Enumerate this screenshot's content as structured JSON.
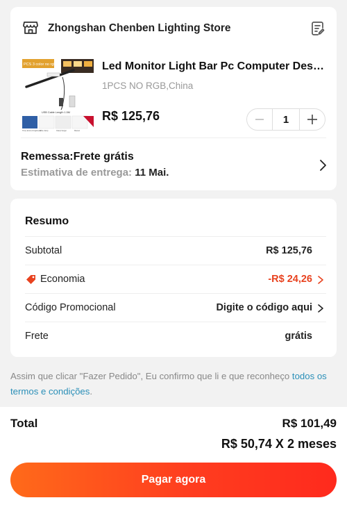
{
  "store": {
    "name": "Zhongshan Chenben Lighting Store",
    "icon": "storefront-icon",
    "note_icon": "note-edit-icon"
  },
  "product": {
    "title": "Led Monitor Light Bar Pc Computer Desk ...",
    "variant": "1PCS NO RGB,China",
    "price": "R$ 125,76",
    "quantity": "1",
    "image": {
      "banner_text": "PCS 3 color no rgb",
      "cable_text": "USB Cable Length 1.5M",
      "captions": [
        "Three kinds of brightness",
        "Wide clamp",
        "Clamp hanger",
        "Manual"
      ]
    }
  },
  "shipping": {
    "title": "Remessa:Frete grátis",
    "estimate_label": "Estimativa de entrega: ",
    "estimate_date": "11 Mai."
  },
  "summary": {
    "title": "Resumo",
    "rows": [
      {
        "label": "Subtotal",
        "value": "R$ 125,76"
      },
      {
        "label": "Economia",
        "value": "-R$ 24,26"
      },
      {
        "label": "Código Promocional",
        "value": "Digite o código aqui"
      },
      {
        "label": "Frete",
        "value": "grátis"
      }
    ]
  },
  "disclaimer": {
    "text": "Assim que clicar \"Fazer Pedido\", Eu confirmo que li e que reconheço ",
    "link": "todos os termos e condições",
    "suffix": "."
  },
  "footer": {
    "total_label": "Total",
    "total_value": "R$ 101,49",
    "installments": "R$ 50,74 X 2 meses",
    "pay_button": "Pagar agora"
  },
  "colors": {
    "accent": "#ff3d1f",
    "discount": "#e8421f",
    "link": "#2a8fb8"
  }
}
